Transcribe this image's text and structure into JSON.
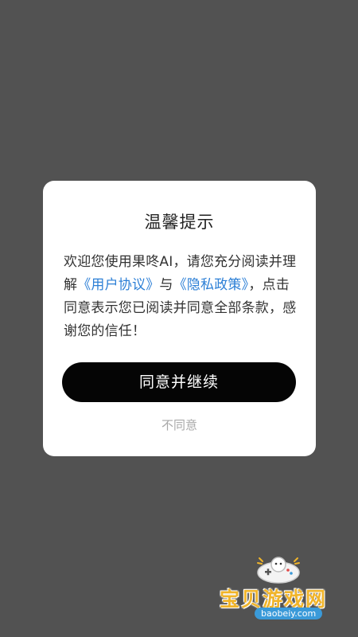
{
  "dialog": {
    "title": "温馨提示",
    "message_part1": "欢迎您使用果咚AI，请您充分阅读并理解",
    "user_agreement_link": "《用户协议》",
    "message_part2": "与",
    "privacy_policy_link": "《隐私政策》",
    "message_part3": "，点击同意表示您已阅读并同意全部条款，感谢您的信任！",
    "agree_button_label": "同意并继续",
    "disagree_button_label": "不同意"
  },
  "watermark": {
    "site_name": "宝贝游戏网",
    "site_url": "baobeiy.com",
    "logo_icon": "gamepad-icon"
  },
  "colors": {
    "background": "#525252",
    "dialog_bg": "#ffffff",
    "link": "#2c7fd6",
    "agree_button_bg": "#050505",
    "disagree_text": "#a8a8a8",
    "watermark_text": "#f0b42a"
  }
}
